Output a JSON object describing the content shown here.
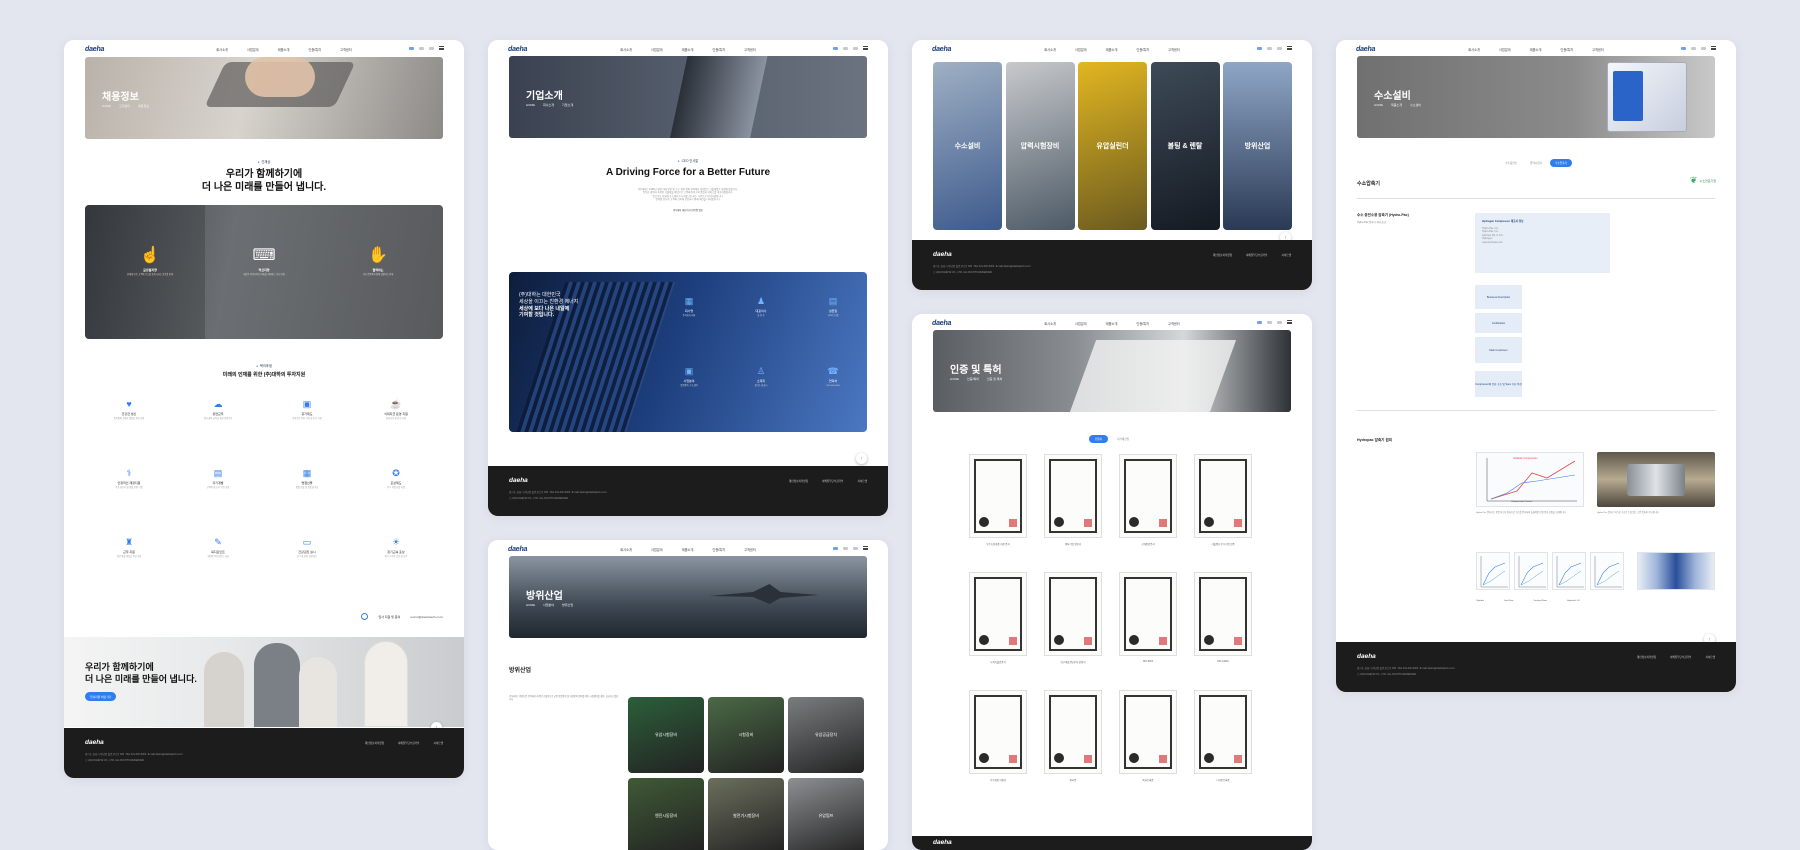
{
  "nav": {
    "logo": "daeha",
    "menu": [
      "회사소개",
      "사업분야",
      "제품소개",
      "인증/특허",
      "고객센터"
    ],
    "lang": [
      "KO",
      "EN"
    ]
  },
  "card1": {
    "hero_title": "채용정보",
    "crumbs": [
      "HOME",
      "고객센터",
      "채용정보"
    ],
    "kicker": "인재상",
    "headline1": "우리가 함께하기에",
    "headline2": "더 나은 미래를 만들어 냅니다.",
    "values": [
      {
        "t": "글로벌지향",
        "d": "전세계 모든 고객의 니즈를 충족시키는 글로벌 인재"
      },
      {
        "t": "혁신지향",
        "d": "새로운 아이디어로 미래를 개척하는 혁신 인재"
      },
      {
        "t": "협력하는",
        "d": "서로 존중하며 함께 성장하는 인재"
      }
    ],
    "kicker2": "복리후생",
    "welfare_title": "미래의 인재를 위한 (주)대하의 투자지원",
    "welfare": [
      {
        "t": "건강한 생산",
        "d": "임직원의 건강한 생활을 위한 지원"
      },
      {
        "t": "유연근무",
        "d": "일과 삶의 균형을 위한 유연근무"
      },
      {
        "t": "휴가제도",
        "d": "자유로운 연차 사용 및 휴가 지원"
      },
      {
        "t": "식대지급 운영 지원",
        "d": "점심식사 및 간식 지원"
      },
      {
        "t": "안정적인 재정지원",
        "d": "각종 경조사 및 생활 안정 지원"
      },
      {
        "t": "자기계발",
        "d": "교육비 및 도서 구입 지원"
      },
      {
        "t": "명절선물",
        "d": "명절 선물 및 상품권 지급"
      },
      {
        "t": "포상제도",
        "d": "우수 사원 포상 지원"
      },
      {
        "t": "근무 지원",
        "d": "업무 환경 개선을 위한 지원"
      },
      {
        "t": "복지포인트",
        "d": "개인별 복지포인트 지급"
      },
      {
        "t": "건강검진 실시",
        "d": "연 1회 종합 건강검진"
      },
      {
        "t": "장기근속 포상",
        "d": "장기 근속자 포상 및 휴가"
      }
    ],
    "contact_label": "입사 지원 및 문의",
    "contact_email": "recruit@daehatech.co.kr",
    "banner1": "우리가 함께하기에",
    "banner2": "더 나은 미래를 만들어 냅니다.",
    "banner_btn": "입사지원 바로가기"
  },
  "footer": {
    "logo": "daeha",
    "addr": "경기도 화성시 향남읍 발안공단로 000",
    "tel": "TEL 031-000-0000",
    "fax": "FAX 031-000-0000",
    "email": "E-mail daeha@daehatech.co.kr",
    "copy": "ⓒ 2024 DAEHA CO., LTD. ALL RIGHTS RESERVED.",
    "links": [
      "개인정보처리방침",
      "이메일무단수집거부",
      "사이트맵"
    ]
  },
  "card2": {
    "hero_title": "기업소개",
    "crumbs": [
      "HOME",
      "회사소개",
      "기업소개"
    ],
    "kicker": "CEO 인사말",
    "headline": "A Driving Force for a Better Future",
    "body": [
      "(주)대하는 1995년 설립 이래 유압 및 수소 관련 장비 분야에서 끊임없는 기술개발로 성장해 왔습니다.",
      "풍부한 경험과 축적된 기술력을 바탕으로 고객에게 최고의 품질과 서비스를 제공하겠습니다.",
      "앞으로도 친환경 수소에너지 시대를 선도하는 기업으로 나아가겠습니다.",
      "임직원 모두가 고객의 신뢰에 보답하기 위해 최선을 다하겠습니다."
    ],
    "sign": "(주)대하 대표이사 임직원 일동",
    "panel1": "(주)대하는 대한민국",
    "panel2": "세상을 이끄는 친환경 에너지",
    "panel3": "세상에 보다 나은 내일에",
    "panel4": "기여할 것입니다.",
    "icons": [
      {
        "t": "회사명",
        "d": "주식회사 대하"
      },
      {
        "t": "대표이사",
        "d": "홍 길 동"
      },
      {
        "t": "설립일",
        "d": "1995년 3월"
      },
      {
        "t": "사업분야",
        "d": "유압장비, 수소설비"
      },
      {
        "t": "소재지",
        "d": "경기도 화성시"
      },
      {
        "t": "연락처",
        "d": "031-000-0000"
      }
    ]
  },
  "card3": {
    "hero_title": "방위산업",
    "crumbs": [
      "HOME",
      "사업분야",
      "방위산업"
    ],
    "section": "방위산업",
    "body": "(주)대하는 방위산업 분야에서 축적된 기술력으로 군용 유압장비 및 지상장비 정비를 위한 시험장비를 개발, 공급하고 있습니다.",
    "products": [
      "유압시험장비",
      "시험장비",
      "유압공급장치",
      "엔진시동장비",
      "발전기시험장비",
      "유압펌프"
    ]
  },
  "card4": {
    "categories": [
      "수소설비",
      "압력시험장비",
      "유압실린더",
      "볼팅 & 렌탈",
      "방위산업"
    ]
  },
  "card5": {
    "hero_title": "인증 및 특허",
    "crumbs": [
      "HOME",
      "인증/특허",
      "인증 및 특허"
    ],
    "tabs": [
      "인증서",
      "지식재산권"
    ],
    "certs": [
      "우수조달제품 지정 증서",
      "벤처기업 확인서",
      "신제품인증서",
      "기술평가 우수기업 인증",
      "녹색기술인증서",
      "연구개발전담부서 인정서",
      "ISO 9001",
      "ISO 14001",
      "우수제품 지정서",
      "특허증",
      "특허등록증",
      "디자인등록증"
    ]
  },
  "card6": {
    "hero_title": "수소설비",
    "crumbs": [
      "HOME",
      "제품소개",
      "수소설비"
    ],
    "tabs": [
      "수소충전소",
      "압력시험기",
      "수소압축기"
    ],
    "section": "수소압축기",
    "partner": "수소연료기업",
    "product_title": "수소 충전소용 압축기 (Hydro-Pac)",
    "product_sub": "Hydro-Pac 압축기 국내 공급",
    "spec_title": "Hydrogen Compressor 제조사 정보",
    "spec": [
      "Hydro-Pac, Inc.",
      "Hydro-Pac, Inc.",
      "Fairview, PA, U.S.A.",
      "Hydrogen",
      "www.hydropac.com"
    ],
    "rows": [
      "Business Description",
      "Certification",
      "Main Customers",
      "Compressor의 종류 구조 및 Spec 주요 특징"
    ],
    "section2": "Hydropac 압축기 원리",
    "diagram_title": "Adiabatic Compression",
    "diagram_sub": "Compression Process",
    "legend": [
      "Cylinder",
      "Gas Flow",
      "Cooling Water",
      "Hydraulic Oil"
    ]
  }
}
